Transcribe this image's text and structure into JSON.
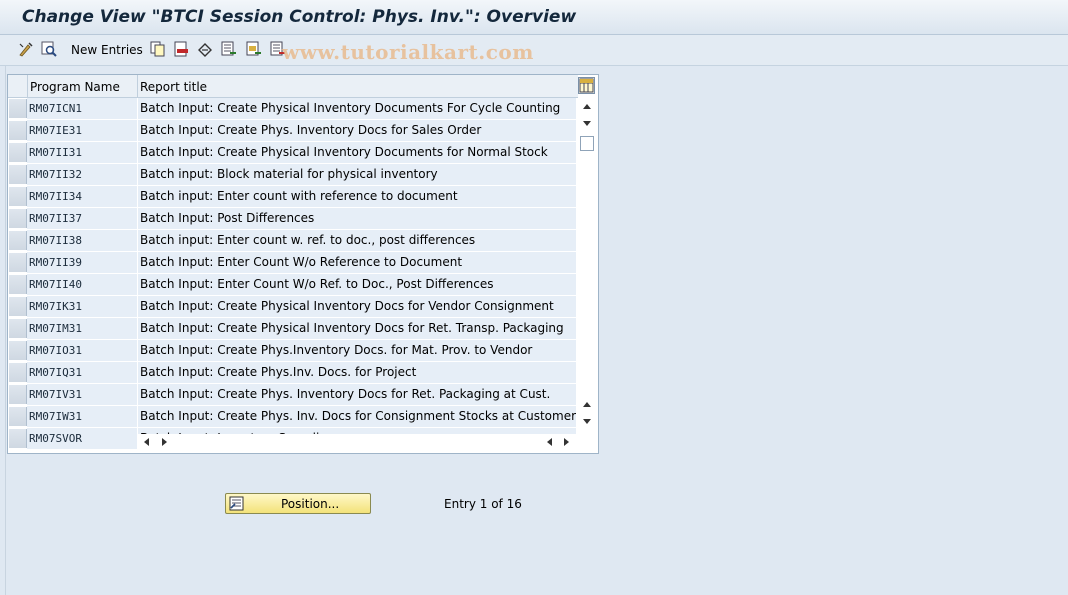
{
  "window": {
    "title": "Change View \"BTCI Session Control: Phys. Inv.\": Overview"
  },
  "toolbar": {
    "new_entries_label": "New Entries",
    "icons": [
      "edit-toggle-icon",
      "display-icon",
      "copy-icon",
      "delete-icon",
      "undo-icon",
      "select-all-icon",
      "select-block-icon",
      "deselect-all-icon"
    ]
  },
  "watermark": "www.tutorialkart.com",
  "table": {
    "columns": [
      "Program Name",
      "Report title"
    ],
    "rows": [
      {
        "program": "RM07ICN1",
        "title": "Batch Input: Create Physical Inventory Documents For Cycle Counting"
      },
      {
        "program": "RM07IE31",
        "title": "Batch Input: Create Phys. Inventory Docs for Sales Order"
      },
      {
        "program": "RM07II31",
        "title": "Batch Input: Create Physical Inventory Documents for Normal Stock"
      },
      {
        "program": "RM07II32",
        "title": "Batch input: Block material for physical inventory"
      },
      {
        "program": "RM07II34",
        "title": "Batch input: Enter count with reference to document"
      },
      {
        "program": "RM07II37",
        "title": "Batch Input: Post Differences"
      },
      {
        "program": "RM07II38",
        "title": "Batch input: Enter count w. ref. to doc., post differences"
      },
      {
        "program": "RM07II39",
        "title": "Batch Input: Enter Count W/o Reference to Document"
      },
      {
        "program": "RM07II40",
        "title": "Batch Input: Enter Count W/o Ref. to Doc., Post Differences"
      },
      {
        "program": "RM07IK31",
        "title": "Batch Input: Create Physical Inventory Docs for Vendor Consignment"
      },
      {
        "program": "RM07IM31",
        "title": "Batch Input: Create Physical Inventory Docs for Ret. Transp. Packaging"
      },
      {
        "program": "RM07IO31",
        "title": "Batch Input: Create Phys.Inventory Docs. for Mat. Prov. to Vendor"
      },
      {
        "program": "RM07IQ31",
        "title": "Batch Input: Create Phys.Inv. Docs. for Project"
      },
      {
        "program": "RM07IV31",
        "title": "Batch Input: Create Phys. Inventory Docs for Ret. Packaging at Cust."
      },
      {
        "program": "RM07IW31",
        "title": "Batch Input: Create Phys. Inv. Docs for Consignment Stocks at Customer"
      },
      {
        "program": "RM07SVOR",
        "title": "Batch Input: Inventory Sampling"
      }
    ]
  },
  "footer": {
    "position_button": "Position...",
    "entry_text": "Entry 1 of 16"
  }
}
